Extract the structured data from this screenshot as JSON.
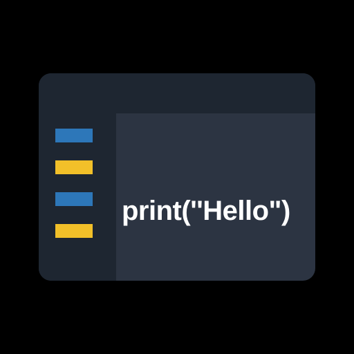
{
  "editor": {
    "code_line": "print(''Hello\")"
  },
  "sidebar": {
    "items": [
      {
        "color": "blue"
      },
      {
        "color": "yellow"
      },
      {
        "color": "blue"
      },
      {
        "color": "yellow"
      }
    ]
  }
}
